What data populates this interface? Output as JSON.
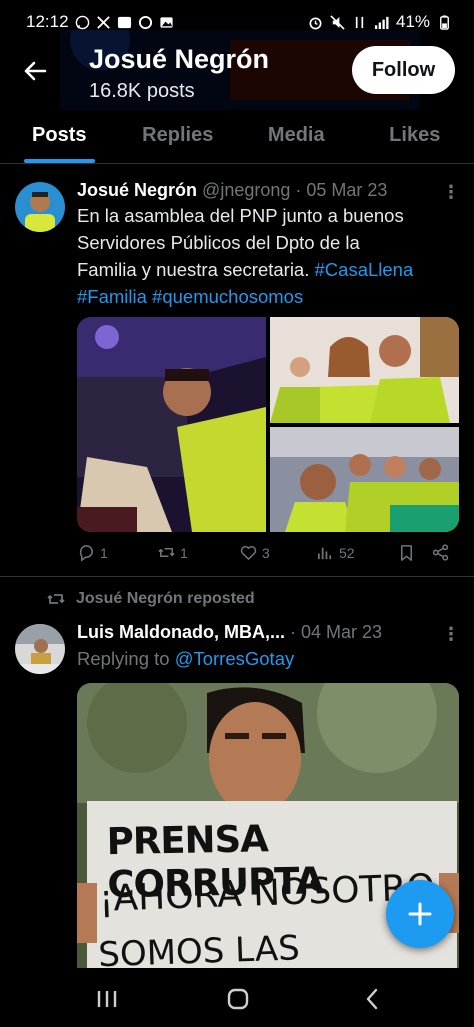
{
  "status_bar": {
    "time": "12:12",
    "battery": "41%"
  },
  "header": {
    "name": "Josué Negrón",
    "post_count": "16.8K posts",
    "follow_label": "Follow"
  },
  "tabs": [
    {
      "label": "Posts",
      "active": true
    },
    {
      "label": "Replies",
      "active": false
    },
    {
      "label": "Media",
      "active": false
    },
    {
      "label": "Likes",
      "active": false
    }
  ],
  "tweet1": {
    "name": "Josué Negrón",
    "meta": "@jnegrong · 05 Mar 23",
    "text_lines": [
      "En la asamblea del PNP junto a buenos",
      "Servidores Públicos del Dpto de la",
      "Familia y nuestra secretaria."
    ],
    "hashtags_line3": "#CasaLlena",
    "hashtags_line4": "#Familia #quemuchosomos",
    "replies": "1",
    "reposts": "1",
    "likes": "3",
    "views": "52"
  },
  "repost_banner": "Josué Negrón reposted",
  "tweet2": {
    "name": "Luis Maldonado, MBA,...",
    "meta": "· 04 Mar 23",
    "replying_prefix": "Replying to",
    "replying_handle": "@TorresGotay",
    "sign_line1": "PRENSA CORRUPTA",
    "sign_line2": "¡AHORA NOSOTRO",
    "sign_line3": "SOMOS LAS NOTICIAS!"
  },
  "colors": {
    "accent": "#1d9bf0",
    "background": "#000000",
    "muted": "#71767b"
  },
  "icons": {
    "back": "arrow-left-icon",
    "more": "more-vertical-icon",
    "reply": "reply-icon",
    "repost": "repost-icon",
    "like": "heart-icon",
    "views": "views-icon",
    "bookmark": "bookmark-icon",
    "share": "share-icon",
    "compose": "plus-icon"
  }
}
